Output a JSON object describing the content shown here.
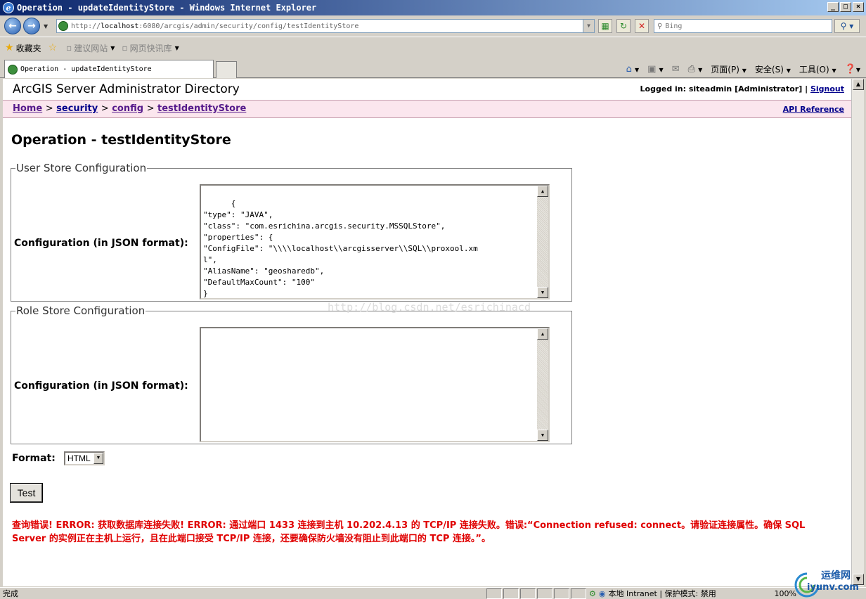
{
  "window": {
    "title": "Operation - updateIdentityStore - Windows Internet Explorer"
  },
  "toolbar": {
    "address_prefix": "http://",
    "address_host": "localhost",
    "address_rest": ":6080/arcgis/admin/security/config/testIdentityStore",
    "search_placeholder": "Bing"
  },
  "favorites": {
    "favorites_label": "收藏夹",
    "suggested_sites": "建议网站",
    "web_slices": "网页快讯库"
  },
  "tabs": [
    {
      "label": "Operation - updateIdentityStore"
    }
  ],
  "command_bar": {
    "page": "页面(P)",
    "safety": "安全(S)",
    "tools": "工具(O)"
  },
  "header": {
    "app_title": "ArcGIS Server Administrator Directory",
    "logged_in_prefix": "Logged in: siteadmin [Administrator] |",
    "signout": "Signout"
  },
  "breadcrumb": {
    "home": "Home",
    "security": "security",
    "config": "config",
    "current": "testIdentityStore",
    "sep": ">",
    "api_reference": "API Reference"
  },
  "operation": {
    "title": "Operation - testIdentityStore"
  },
  "user_store": {
    "legend": "User Store Configuration",
    "label": "Configuration (in JSON format):",
    "value": "{\n\"type\": \"JAVA\",\n\"class\": \"com.esrichina.arcgis.security.MSSQLStore\",\n\"properties\": {\n\"ConfigFile\": \"\\\\\\\\localhost\\\\arcgisserver\\\\SQL\\\\proxool.xm\nl\",\n\"AliasName\": \"geosharedb\",\n\"DefaultMaxCount\": \"100\"\n}\n}"
  },
  "role_store": {
    "legend": "Role Store Configuration",
    "label": "Configuration (in JSON format):",
    "value": ""
  },
  "watermark": "http://blog.csdn.net/esrichinacd",
  "format": {
    "label": "Format:",
    "selected": "HTML"
  },
  "test_button": "Test",
  "error_message": "查询错误! ERROR: 获取数据库连接失败! ERROR: 通过端口 1433 连接到主机 10.202.4.13 的 TCP/IP 连接失败。错误:“Connection refused: connect。请验证连接属性。确保 SQL Server 的实例正在主机上运行，且在此端口接受 TCP/IP 连接，还要确保防火墙没有阻止到此端口的 TCP 连接。”。",
  "statusbar": {
    "done": "完成",
    "zone": "本地 Intranet | 保护模式: 禁用",
    "zoom": "100%"
  },
  "brand": {
    "line1": "运维网",
    "line2": "iyunv.com"
  }
}
